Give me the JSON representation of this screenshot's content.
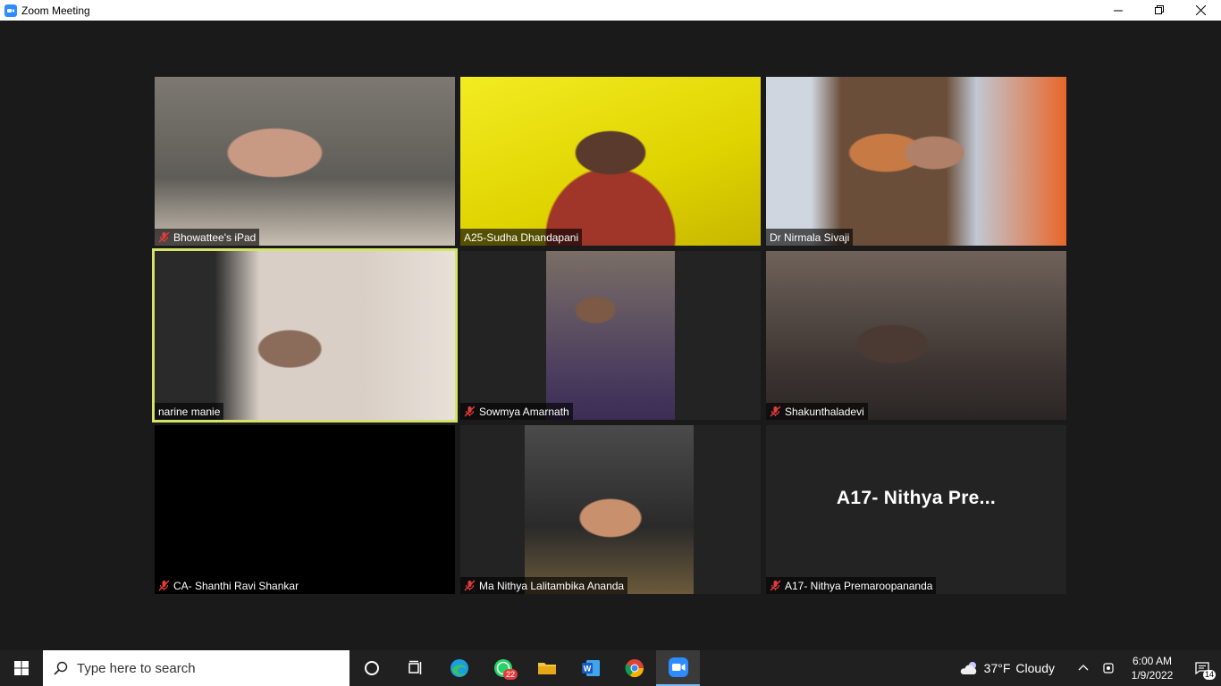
{
  "window": {
    "title": "Zoom Meeting",
    "icon": "zoom-camera-icon",
    "controls": [
      "minimize-icon",
      "restore-icon",
      "close-icon"
    ]
  },
  "participants": [
    {
      "name": "Bhowattee's iPad",
      "muted": true,
      "video": true
    },
    {
      "name": "A25-Sudha Dhandapani",
      "muted": false,
      "video": true
    },
    {
      "name": "Dr Nirmala Sivaji",
      "muted": false,
      "video": true
    },
    {
      "name": "narine manie",
      "muted": false,
      "video": true,
      "active_speaker": true
    },
    {
      "name": "Sowmya Amarnath",
      "muted": true,
      "video": true
    },
    {
      "name": "Shakunthaladevi",
      "muted": true,
      "video": true
    },
    {
      "name": "CA- Shanthi Ravi Shankar",
      "muted": true,
      "video": true
    },
    {
      "name": "Ma Nithya Lalitambika Ananda",
      "muted": true,
      "video": true
    },
    {
      "name": "A17- Nithya Premaroopananda",
      "muted": true,
      "video": false,
      "center_label": "A17- Nithya Pre..."
    }
  ],
  "taskbar": {
    "search_placeholder": "Type here to search",
    "apps": [
      {
        "name": "cortana-circle-icon"
      },
      {
        "name": "task-view-icon"
      },
      {
        "name": "edge-browser-icon"
      },
      {
        "name": "whatsapp-icon",
        "badge": "22"
      },
      {
        "name": "file-explorer-icon"
      },
      {
        "name": "word-icon"
      },
      {
        "name": "chrome-icon"
      },
      {
        "name": "zoom-icon",
        "active": true
      }
    ],
    "weather": {
      "temp": "37°F",
      "condition": "Cloudy",
      "icon": "cloud-moon-icon"
    },
    "clock": {
      "time": "6:00 AM",
      "date": "1/9/2022"
    },
    "notifications": "14"
  },
  "colors": {
    "active_speaker_border": "#d6e36a",
    "meeting_bg": "#1a1a1a",
    "tile_bg": "#232323",
    "mute_icon": "#e23b3b"
  }
}
